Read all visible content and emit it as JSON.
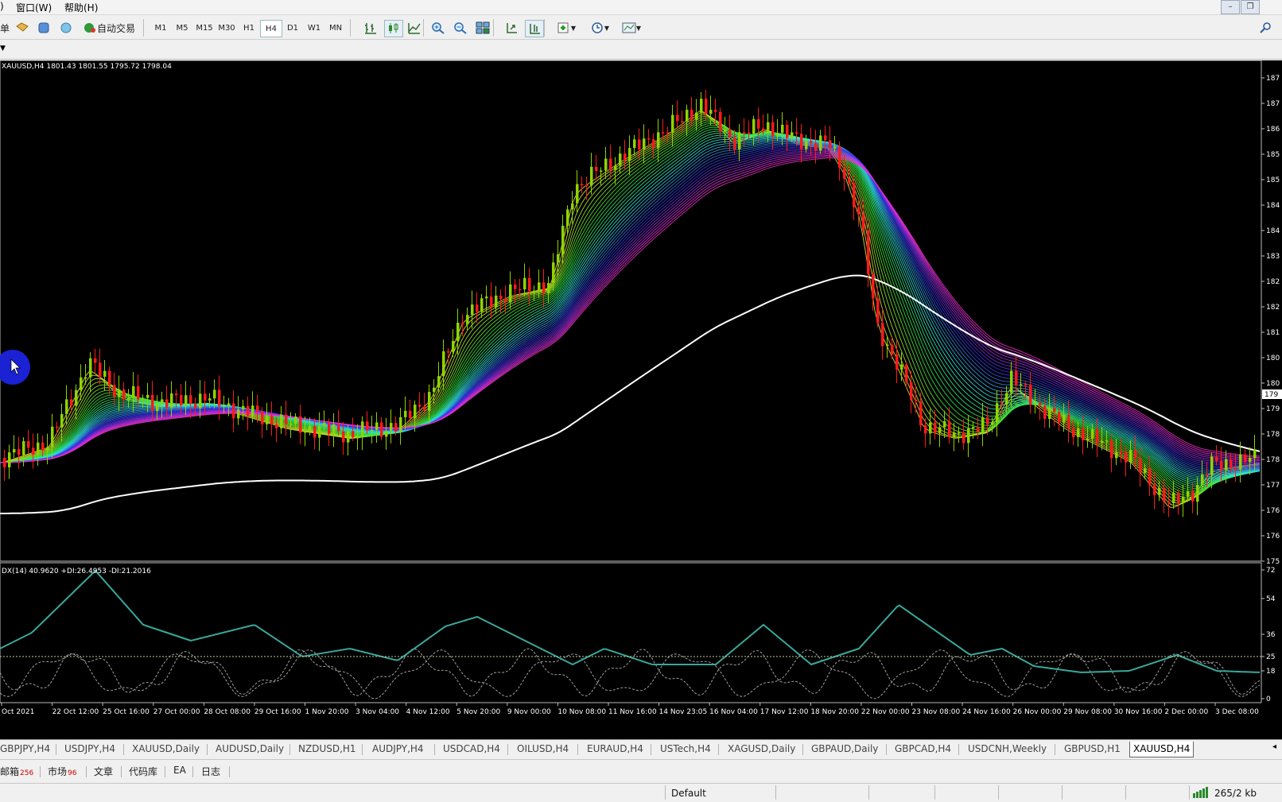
{
  "menu": {
    "window": "窗口(W)",
    "help": "帮助(H)",
    "partial_right": ")"
  },
  "toolbar": {
    "partial_label": "单",
    "autotrade_label": "自动交易",
    "timeframes": [
      "M1",
      "M5",
      "M15",
      "M30",
      "H1",
      "H4",
      "D1",
      "W1",
      "MN"
    ],
    "active_timeframe": "H4",
    "icons": [
      "open-icon",
      "profiles-icon",
      "community-icon",
      "autotrade-icon",
      "bar-chart-icon",
      "candle-chart-icon",
      "line-chart-icon",
      "zoom-in-icon",
      "zoom-out-icon",
      "tile-windows-icon",
      "autoscroll-icon",
      "chart-shift-icon",
      "indicators-icon",
      "periods-icon",
      "templates-icon"
    ]
  },
  "chart": {
    "header": "XAUUSD,H4  1801.43 1801.55 1795.72 1798.04",
    "indicator_header": "DX(14) 40.9620 +DI:26.4953 -DI:21.2016",
    "price_ticks": [
      "187",
      "187",
      "186",
      "185",
      "185",
      "184",
      "184",
      "183",
      "182",
      "182",
      "181",
      "180",
      "180",
      "179",
      "178",
      "178",
      "177",
      "176",
      "176",
      "175"
    ],
    "current_price_label": "179",
    "adx_ticks": [
      "72",
      "54",
      "36",
      "25",
      "18",
      "0"
    ],
    "time_labels": [
      "Oct 2021",
      "22 Oct 12:00",
      "25 Oct 16:00",
      "27 Oct 00:00",
      "28 Oct 08:00",
      "29 Oct 16:00",
      "1 Nov 20:00",
      "3 Nov 04:00",
      "4 Nov 12:00",
      "5 Nov 20:00",
      "9 Nov 00:00",
      "10 Nov 08:00",
      "11 Nov 16:00",
      "14 Nov 23:05",
      "16 Nov 04:00",
      "17 Nov 12:00",
      "18 Nov 20:00",
      "22 Nov 00:00",
      "23 Nov 08:00",
      "24 Nov 16:00",
      "26 Nov 00:00",
      "29 Nov 08:00",
      "30 Nov 16:00",
      "2 Dec 00:00",
      "3 Dec 08:00"
    ],
    "colors": {
      "bull": "#8fd400",
      "bear": "#ff1a1a",
      "adx": "#3aa89c",
      "di": "#a0a0a0",
      "grid": "#2a2a2a",
      "ema_base": "#ffffff"
    }
  },
  "symbol_tabs": [
    "GBPJPY,H4",
    "USDJPY,H4",
    "XAUUSD,Daily",
    "AUDUSD,Daily",
    "NZDUSD,H1",
    "AUDJPY,H4",
    "USDCAD,H4",
    "OILUSD,H4",
    "EURAUD,H4",
    "USTech,H4",
    "XAGUSD,Daily",
    "GBPAUD,Daily",
    "GBPCAD,H4",
    "USDCNH,Weekly",
    "GBPUSD,H1",
    "XAUUSD,H4"
  ],
  "active_tab": "XAUUSD,H4",
  "bottom_tabs": [
    {
      "label": "邮箱",
      "count": "256"
    },
    {
      "label": "市场",
      "count": "96"
    },
    {
      "label": "文章",
      "count": ""
    },
    {
      "label": "代码库",
      "count": ""
    },
    {
      "label": "EA",
      "count": ""
    },
    {
      "label": "日志",
      "count": ""
    }
  ],
  "status": {
    "profile": "Default",
    "traffic": "265/2 kb"
  }
}
